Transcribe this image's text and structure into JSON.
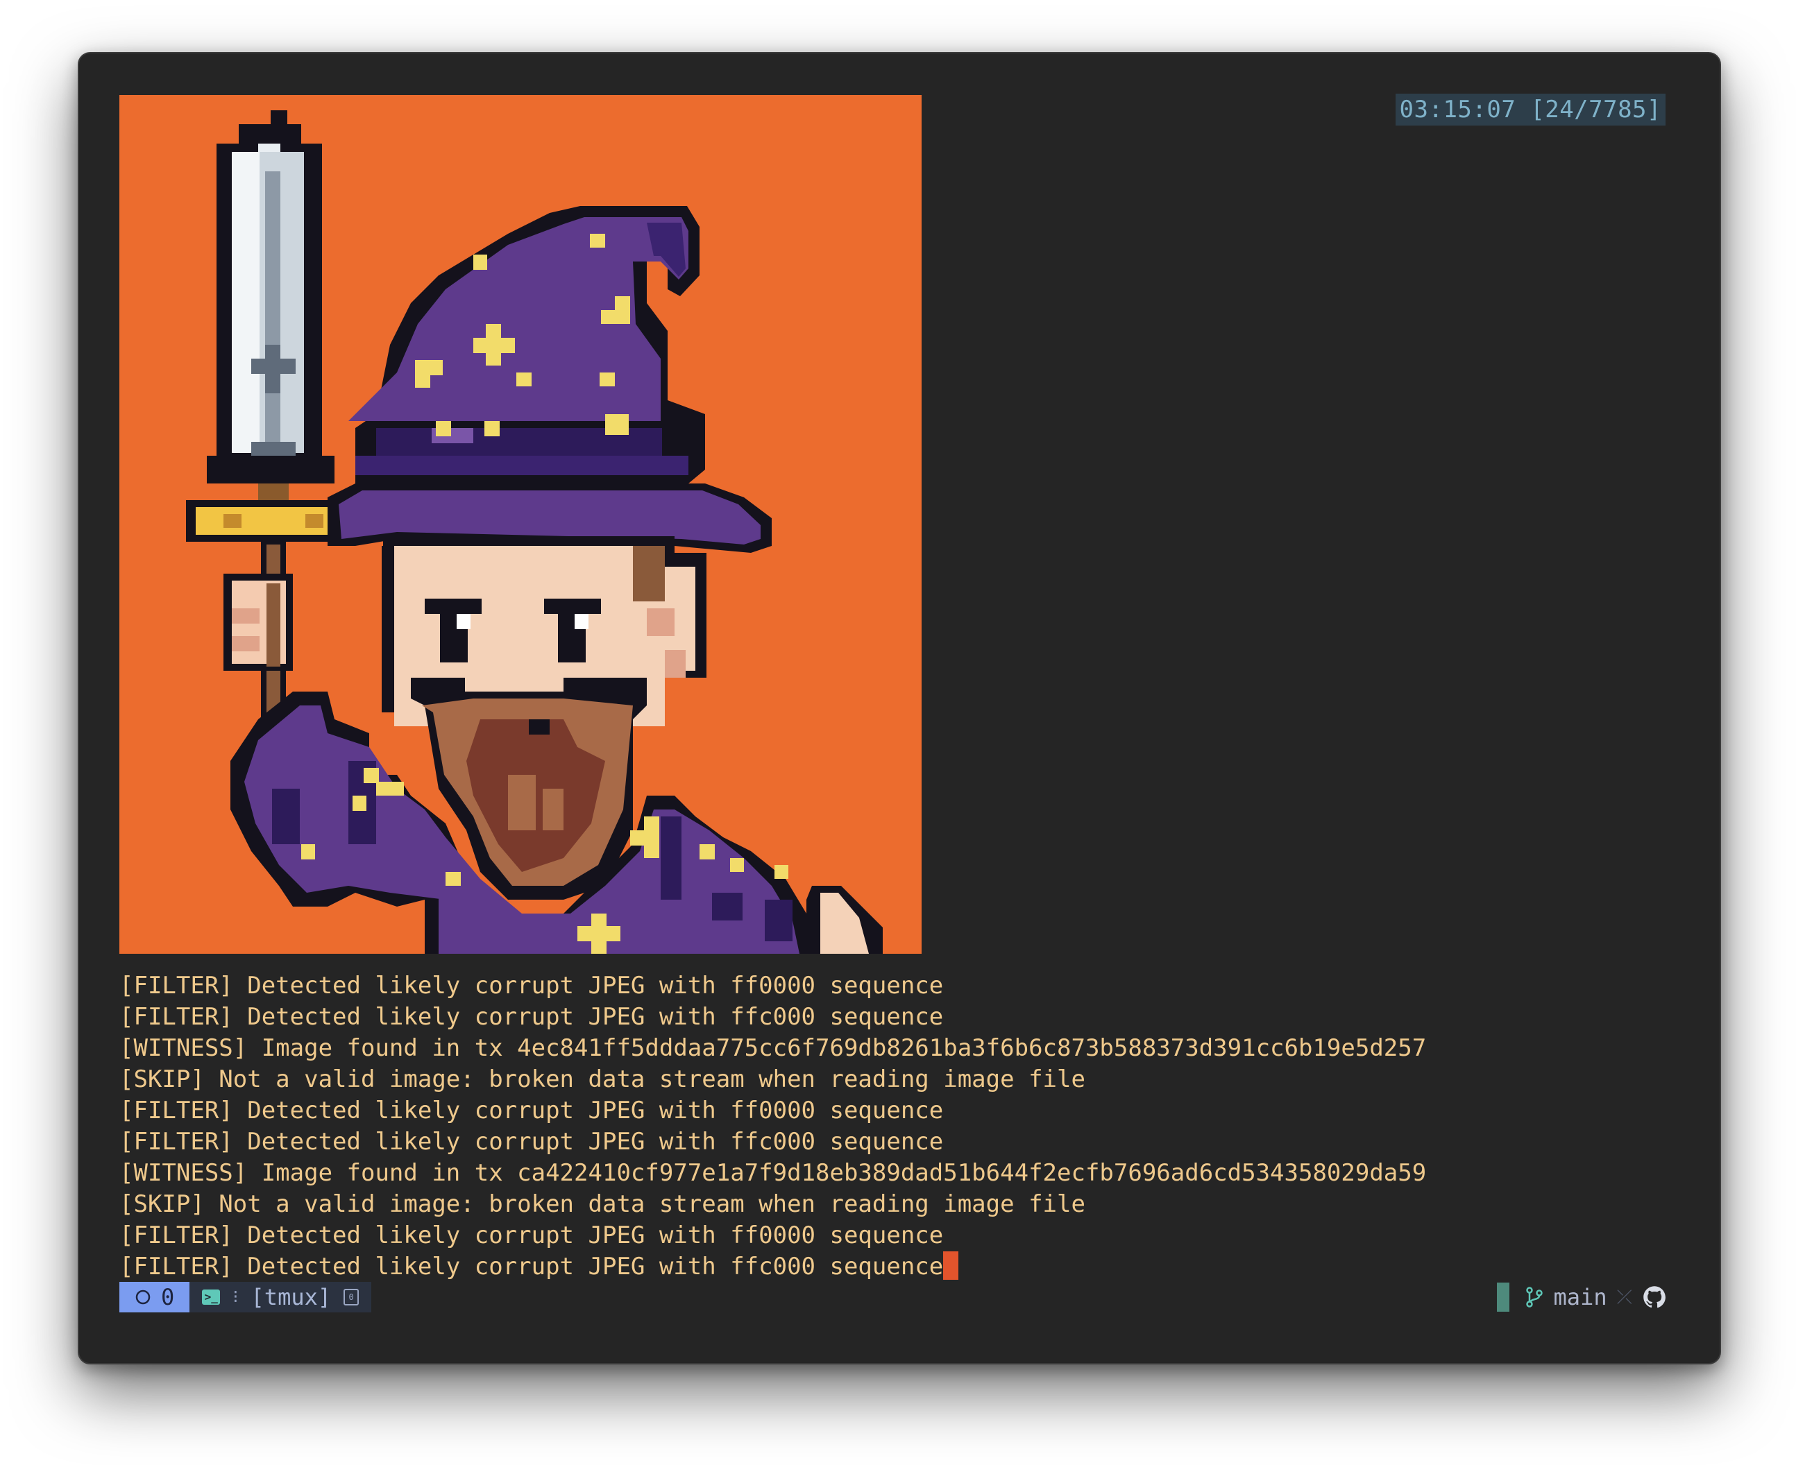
{
  "header": {
    "timestamp": "03:15:07 [24/7785]"
  },
  "image": {
    "description_icon": "pixel-art-wizard"
  },
  "log": {
    "lines": [
      "[FILTER] Detected likely corrupt JPEG with ff0000 sequence",
      "[FILTER] Detected likely corrupt JPEG with ffc000 sequence",
      "[WITNESS] Image found in tx 4ec841ff5dddaa775cc6f769db8261ba3f6b6c873b588373d391cc6b19e5d257",
      "[SKIP] Not a valid image: broken data stream when reading image file",
      "[FILTER] Detected likely corrupt JPEG with ff0000 sequence",
      "[FILTER] Detected likely corrupt JPEG with ffc000 sequence",
      "[WITNESS] Image found in tx ca422410cf977e1a7f9d18eb389dad51b644f2ecfb7696ad6cd534358029da59",
      "[SKIP] Not a valid image: broken data stream when reading image file",
      "[FILTER] Detected likely corrupt JPEG with ff0000 sequence",
      "[FILTER] Detected likely corrupt JPEG with ffc000 sequence"
    ]
  },
  "status": {
    "count": "0",
    "session": "[tmux]",
    "branch": "main"
  },
  "colors": {
    "background": "#252525",
    "log_text": "#efc98c",
    "art_background": "#ec6c2e",
    "cursor": "#e2542c",
    "status_accent": "#7b9cf0"
  }
}
